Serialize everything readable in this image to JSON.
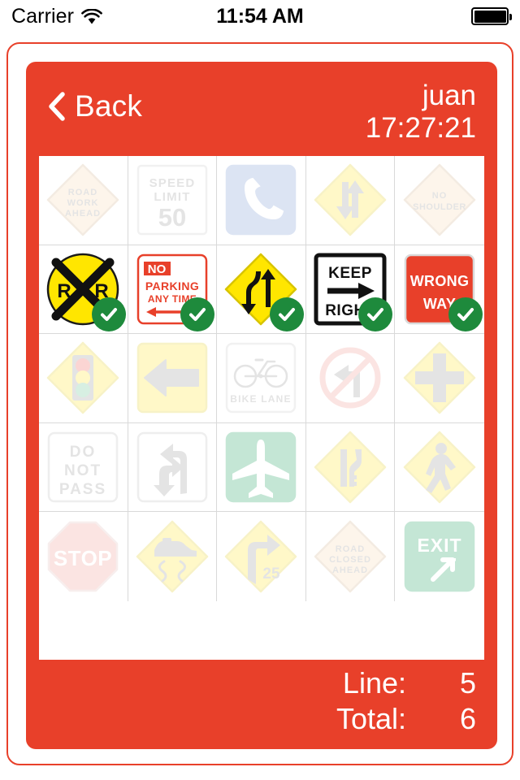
{
  "status_bar": {
    "carrier": "Carrier",
    "wifi_icon": "wifi-icon",
    "time": "11:54 AM",
    "battery_icon": "battery-full-icon"
  },
  "header": {
    "back_icon": "chevron-left-icon",
    "back_label": "Back",
    "user_name": "juan",
    "timer": "17:27:21"
  },
  "colors": {
    "brand_red": "#E8402A",
    "check_green": "#1E8A3C",
    "sign_yellow": "#FFE94D",
    "sign_orange": "#F5A623",
    "sign_green": "#1E8A3C",
    "sign_blue": "#8FA8DA"
  },
  "footer": {
    "line_label": "Line:",
    "line_value": "5",
    "total_label": "Total:",
    "total_value": "6"
  },
  "grid": {
    "columns": 5,
    "rows": 5,
    "cells": [
      {
        "id": "road-work-ahead",
        "icon": "road-work-ahead-sign",
        "label": "ROAD WORK AHEAD",
        "shape": "diamond",
        "color": "orange",
        "state": "faded",
        "checked": false
      },
      {
        "id": "speed-limit-50",
        "icon": "speed-limit-sign",
        "label": "SPEED LIMIT 50",
        "shape": "rect",
        "color": "white",
        "state": "faded",
        "checked": false
      },
      {
        "id": "telephone",
        "icon": "telephone-sign",
        "label": "",
        "shape": "rect",
        "color": "blue",
        "state": "faded",
        "checked": false
      },
      {
        "id": "two-way-traffic",
        "icon": "two-way-traffic-sign",
        "label": "",
        "shape": "diamond",
        "color": "yellow",
        "state": "faded",
        "checked": false
      },
      {
        "id": "no-shoulder",
        "icon": "no-shoulder-sign",
        "label": "NO SHOULDER",
        "shape": "diamond",
        "color": "orange",
        "state": "faded",
        "checked": false
      },
      {
        "id": "railroad-crossing",
        "icon": "railroad-crossing-sign",
        "label": "R R",
        "shape": "circle",
        "color": "yellow",
        "state": "active",
        "checked": true
      },
      {
        "id": "no-parking-any-time",
        "icon": "no-parking-sign",
        "label": "NO PARKING ANY TIME",
        "shape": "rect",
        "color": "white",
        "state": "active",
        "checked": true
      },
      {
        "id": "divided-highway",
        "icon": "divided-highway-sign",
        "label": "",
        "shape": "diamond",
        "color": "yellow",
        "state": "active",
        "checked": true
      },
      {
        "id": "keep-right",
        "icon": "keep-right-sign",
        "label": "KEEP RIGHT",
        "shape": "rect",
        "color": "white",
        "state": "active",
        "checked": true
      },
      {
        "id": "wrong-way",
        "icon": "wrong-way-sign",
        "label": "WRONG WAY",
        "shape": "rect",
        "color": "red",
        "state": "active",
        "checked": true
      },
      {
        "id": "traffic-signal-ahead",
        "icon": "traffic-signal-sign",
        "label": "",
        "shape": "diamond",
        "color": "yellow",
        "state": "faded",
        "checked": false
      },
      {
        "id": "left-arrow",
        "icon": "left-arrow-sign",
        "label": "",
        "shape": "rect",
        "color": "yellow",
        "state": "faded",
        "checked": false
      },
      {
        "id": "bike-lane",
        "icon": "bike-lane-sign",
        "label": "BIKE LANE",
        "shape": "rect",
        "color": "white",
        "state": "faded",
        "checked": false
      },
      {
        "id": "no-left-turn",
        "icon": "no-left-turn-sign",
        "label": "",
        "shape": "rect",
        "color": "white",
        "state": "faded",
        "checked": false
      },
      {
        "id": "crossroad",
        "icon": "crossroad-sign",
        "label": "",
        "shape": "diamond",
        "color": "yellow",
        "state": "faded",
        "checked": false
      },
      {
        "id": "do-not-pass",
        "icon": "do-not-pass-sign",
        "label": "DO NOT PASS",
        "shape": "rect",
        "color": "white",
        "state": "faded",
        "checked": false
      },
      {
        "id": "left-turn-u-turn",
        "icon": "left-turn-u-turn-sign",
        "label": "",
        "shape": "rect",
        "color": "white",
        "state": "faded",
        "checked": false
      },
      {
        "id": "airport",
        "icon": "airport-sign",
        "label": "",
        "shape": "rect",
        "color": "green",
        "state": "faded",
        "checked": false
      },
      {
        "id": "lane-ends-merge",
        "icon": "lane-ends-merge-sign",
        "label": "",
        "shape": "diamond",
        "color": "yellow",
        "state": "faded",
        "checked": false
      },
      {
        "id": "pedestrian-crossing",
        "icon": "pedestrian-crossing-sign",
        "label": "",
        "shape": "diamond",
        "color": "yellow",
        "state": "faded",
        "checked": false
      },
      {
        "id": "stop",
        "icon": "stop-sign",
        "label": "STOP",
        "shape": "octagon",
        "color": "red",
        "state": "faded",
        "checked": false
      },
      {
        "id": "slippery-when-wet",
        "icon": "slippery-when-wet-sign",
        "label": "",
        "shape": "diamond",
        "color": "yellow",
        "state": "faded",
        "checked": false
      },
      {
        "id": "curve-25",
        "icon": "curve-speed-sign",
        "label": "25",
        "shape": "diamond",
        "color": "yellow",
        "state": "faded",
        "checked": false
      },
      {
        "id": "road-closed-ahead",
        "icon": "road-closed-ahead-sign",
        "label": "ROAD CLOSED AHEAD",
        "shape": "diamond",
        "color": "orange",
        "state": "faded",
        "checked": false
      },
      {
        "id": "exit",
        "icon": "exit-sign",
        "label": "EXIT",
        "shape": "rect",
        "color": "green",
        "state": "faded",
        "checked": false
      }
    ]
  }
}
